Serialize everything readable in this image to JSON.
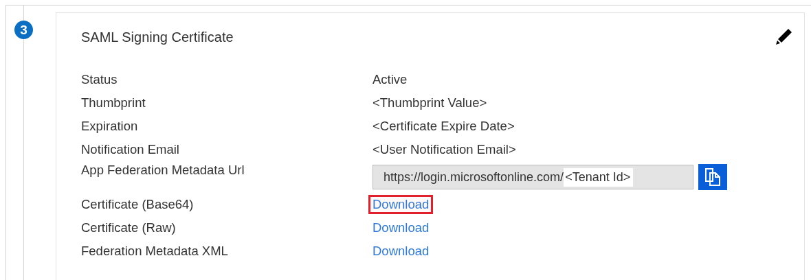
{
  "step": {
    "number": "3"
  },
  "card": {
    "title": "SAML Signing Certificate",
    "rows": [
      {
        "kind": "text",
        "label": "Status",
        "value": "Active"
      },
      {
        "kind": "text",
        "label": "Thumbprint",
        "value": "<Thumbprint Value>"
      },
      {
        "kind": "text",
        "label": "Expiration",
        "value": "<Certificate Expire Date>"
      },
      {
        "kind": "text",
        "label": "Notification Email",
        "value": "<User Notification Email>"
      },
      {
        "kind": "url",
        "label": "App Federation Metadata Url",
        "value": "https://login.microsoftonline.com/",
        "suffix": "<Tenant Id>"
      },
      {
        "kind": "link",
        "label": "Certificate (Base64)",
        "value": "Download",
        "highlighted": true
      },
      {
        "kind": "link",
        "label": "Certificate (Raw)",
        "value": "Download",
        "highlighted": false
      },
      {
        "kind": "link",
        "label": "Federation Metadata XML",
        "value": "Download",
        "highlighted": false
      }
    ]
  }
}
